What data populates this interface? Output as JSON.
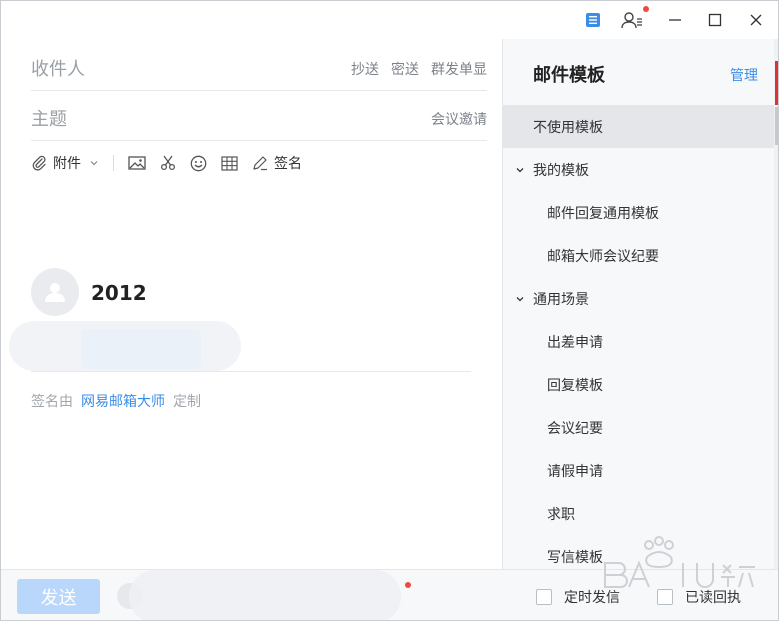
{
  "compose": {
    "recipient_placeholder": "收件人",
    "cc_label": "抄送",
    "bcc_label": "密送",
    "group_send_label": "群发单显",
    "subject_placeholder": "主题",
    "meeting_invite_label": "会议邀请"
  },
  "toolbar": {
    "attachment_label": "附件",
    "signature_label": "签名"
  },
  "signature": {
    "name": "2012",
    "footer_prefix": "签名由",
    "footer_link": "网易邮箱大师",
    "footer_suffix": "定制"
  },
  "templates": {
    "title": "邮件模板",
    "manage_label": "管理",
    "items": [
      {
        "label": "不使用模板",
        "type": "top",
        "active": true
      },
      {
        "label": "我的模板",
        "type": "group"
      },
      {
        "label": "邮件回复通用模板",
        "type": "child"
      },
      {
        "label": "邮箱大师会议纪要",
        "type": "child"
      },
      {
        "label": "通用场景",
        "type": "group"
      },
      {
        "label": "出差申请",
        "type": "child"
      },
      {
        "label": "回复模板",
        "type": "child"
      },
      {
        "label": "会议纪要",
        "type": "child"
      },
      {
        "label": "请假申请",
        "type": "child"
      },
      {
        "label": "求职",
        "type": "child"
      },
      {
        "label": "写信模板",
        "type": "child"
      }
    ]
  },
  "bottom": {
    "send_label": "发送",
    "scheduled_send_label": "定时发信",
    "read_receipt_label": "已读回执"
  },
  "colors": {
    "accent": "#3b8ee6",
    "send_button": "#b8d7fb",
    "notification_dot": "#f04a3e",
    "active_row": "#e4e6e9"
  },
  "icons": {
    "titlebar": [
      "notepad-icon",
      "contacts-icon",
      "minimize-icon",
      "maximize-icon",
      "close-icon"
    ],
    "toolbar": [
      "paperclip-icon",
      "chevron-down-icon",
      "image-icon",
      "scissors-icon",
      "emoji-icon",
      "table-icon",
      "pen-icon"
    ]
  }
}
